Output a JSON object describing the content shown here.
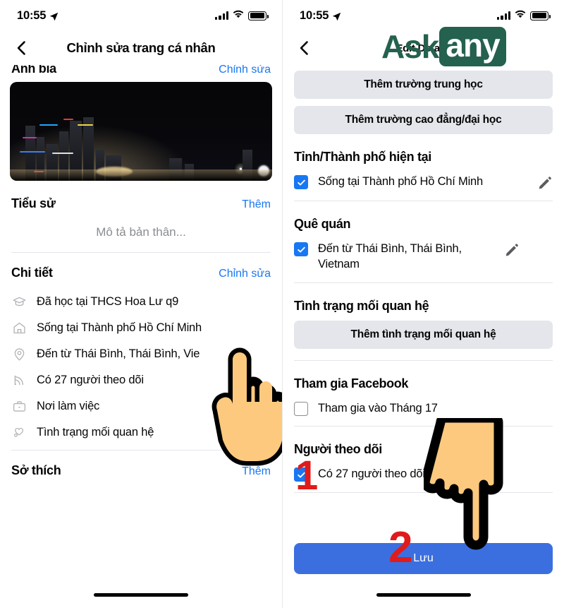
{
  "brand": {
    "logo_ask": "Ask",
    "logo_any": "any",
    "logo_color": "#24614f",
    "accent_blue": "#1877f2",
    "save_blue": "#3b6fe0",
    "annotation_red": "#e01b1b"
  },
  "left": {
    "statusbar": {
      "time": "10:55",
      "location_icon": "location-arrow-icon",
      "signal_icon": "signal-bars-icon",
      "wifi_icon": "wifi-icon",
      "battery_icon": "battery-full-icon"
    },
    "nav": {
      "back_icon": "back-chevron-icon",
      "title": "Chỉnh sửa trang cá nhân"
    },
    "cover_section": {
      "title": "Ảnh bìa",
      "action": "Chỉnh sửa"
    },
    "bio_section": {
      "title": "Tiểu sử",
      "action": "Thêm",
      "placeholder": "Mô tả bản thân..."
    },
    "details_section": {
      "title": "Chi tiết",
      "action": "Chỉnh sửa",
      "items": [
        {
          "icon": "graduation-cap-icon",
          "text": "Đã học tại THCS Hoa Lư q9"
        },
        {
          "icon": "home-icon",
          "text": "Sống tại Thành phố Hồ Chí Minh"
        },
        {
          "icon": "location-pin-icon",
          "text": "Đến từ Thái Bình, Thái Bình, Vie"
        },
        {
          "icon": "rss-followers-icon",
          "text": "Có 27 người theo dõi"
        },
        {
          "icon": "briefcase-icon",
          "text": "Nơi làm việc"
        },
        {
          "icon": "heart-relationship-icon",
          "text": "Tình trạng mối quan hệ"
        }
      ]
    },
    "hobbies_section": {
      "title": "Sở thích",
      "action": "Thêm"
    },
    "hand_cursor": "pointing-hand-up-icon"
  },
  "right": {
    "statusbar": {
      "time": "10:55",
      "location_icon": "location-arrow-icon",
      "signal_icon": "signal-bars-icon",
      "wifi_icon": "wifi-icon",
      "battery_icon": "battery-full-icon"
    },
    "nav": {
      "back_icon": "back-chevron-icon",
      "title": "Edit Details"
    },
    "education_buttons": [
      "Thêm trường trung học",
      "Thêm trường cao đẳng/đại học"
    ],
    "current_city": {
      "title": "Tỉnh/Thành phố hiện tại",
      "checked": true,
      "label": "Sống tại Thành phố Hồ Chí Minh",
      "edit_icon": "pencil-icon"
    },
    "hometown": {
      "title": "Quê quán",
      "checked": true,
      "label": "Đến từ Thái Bình, Thái Bình, Vietnam",
      "edit_icon": "pencil-icon"
    },
    "relationship": {
      "title": "Tình trạng mối quan hệ",
      "button": "Thêm tình trạng mối quan hệ"
    },
    "joined_facebook": {
      "title": "Tham gia Facebook",
      "checked": false,
      "label": "Tham gia vào Tháng              17"
    },
    "followers": {
      "title": "Người theo dõi",
      "checked": true,
      "label": "Có 27 người theo dõi"
    },
    "save_button": "Lưu",
    "hand_cursor": "pointing-hand-down-icon",
    "step_markers": [
      {
        "number": "1"
      },
      {
        "number": "2"
      }
    ]
  }
}
